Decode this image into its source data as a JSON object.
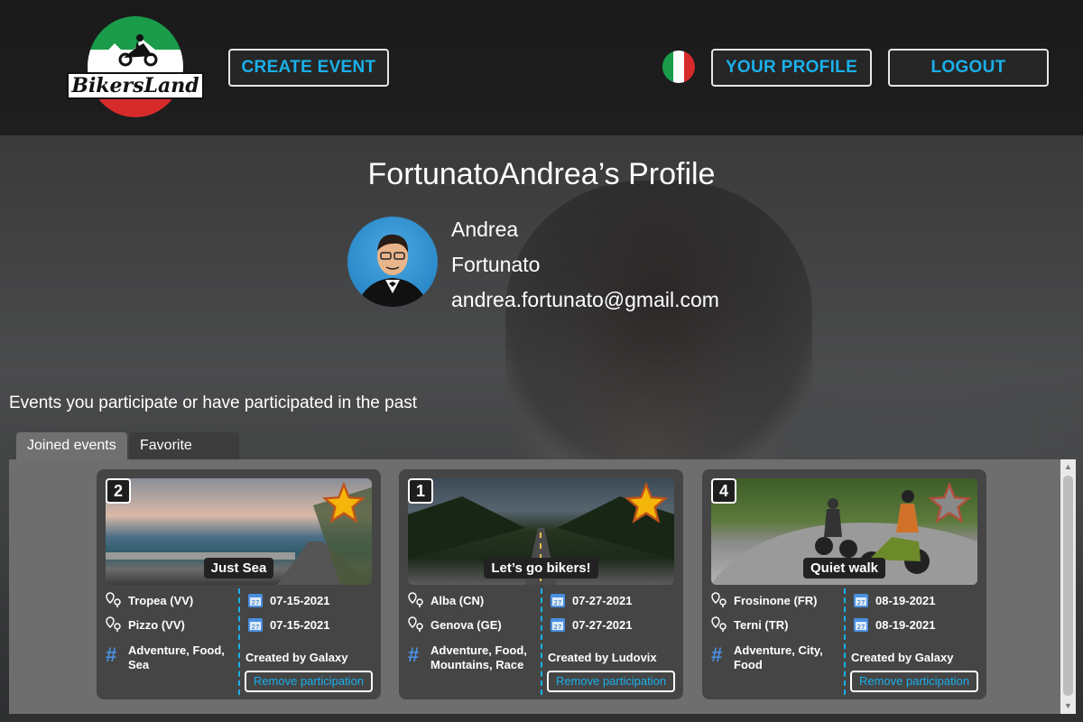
{
  "header": {
    "logo_text": "BikersLand",
    "create_event": "CREATE EVENT",
    "your_profile": "YOUR PROFILE",
    "logout": "LOGOUT",
    "language_flag": "italy-flag-icon"
  },
  "profile": {
    "title": "FortunatoAndrea’s Profile",
    "first_name": "Andrea",
    "last_name": "Fortunato",
    "email": "andrea.fortunato@gmail.com"
  },
  "events_section": {
    "title": "Events you participate or have participated in the past",
    "tabs": [
      {
        "label": "Joined events",
        "active": true
      },
      {
        "label": "Favorite events",
        "active": false
      }
    ]
  },
  "events": [
    {
      "number": "2",
      "title": "Just Sea",
      "favorite": true,
      "from_place": "Tropea (VV)",
      "to_place": "Pizzo (VV)",
      "start_date": "07-15-2021",
      "end_date": "07-15-2021",
      "tags": "Adventure, Food,\nSea",
      "creator": "Created by Galaxy",
      "action": "Remove participation"
    },
    {
      "number": "1",
      "title": "Let’s go bikers!",
      "favorite": true,
      "from_place": "Alba (CN)",
      "to_place": "Genova (GE)",
      "start_date": "07-27-2021",
      "end_date": "07-27-2021",
      "tags": "Adventure, Food,\nMountains, Race",
      "creator": "Created by Ludovix",
      "action": "Remove participation"
    },
    {
      "number": "4",
      "title": "Quiet walk",
      "favorite": false,
      "from_place": "Frosinone (FR)",
      "to_place": "Terni (TR)",
      "start_date": "08-19-2021",
      "end_date": "08-19-2021",
      "tags": "Adventure, City,\nFood",
      "creator": "Created by Galaxy",
      "action": "Remove participation"
    }
  ],
  "colors": {
    "accent": "#1ab0ea",
    "star_gold": "#f5b50a",
    "star_grey": "#8a8a8a"
  }
}
